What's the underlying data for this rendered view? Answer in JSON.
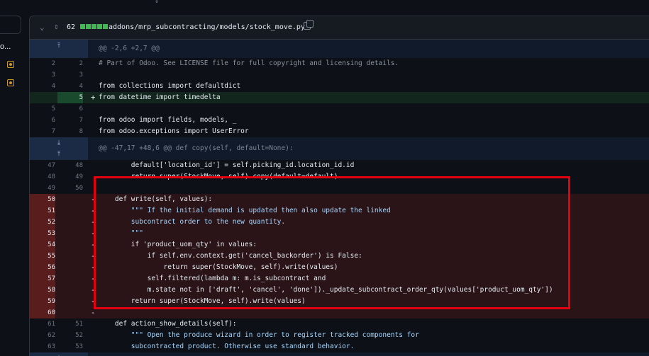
{
  "sidebar": {
    "truncated_label": "o..."
  },
  "file": {
    "count": "62",
    "path": "addons/mrp_subcontracting/models/stock_move.py",
    "diffstat_colors": [
      "#3fb950",
      "#3fb950",
      "#3fb950",
      "#3fb950",
      "#3fb950"
    ]
  },
  "hunks": {
    "h1": "@@ -2,6 +2,7 @@",
    "h2": "@@ -47,17 +48,6 @@ def copy(self, default=None):"
  },
  "lines": [
    {
      "l": "2",
      "r": "2",
      "sign": "",
      "code": "# Part of Odoo. See LICENSE file for full copyright and licensing details."
    },
    {
      "l": "3",
      "r": "3",
      "sign": "",
      "code": ""
    },
    {
      "l": "4",
      "r": "4",
      "sign": "",
      "code": "from collections import defaultdict"
    },
    {
      "l": "",
      "r": "5",
      "sign": "+",
      "code": "from datetime import timedelta"
    },
    {
      "l": "5",
      "r": "6",
      "sign": "",
      "code": ""
    },
    {
      "l": "6",
      "r": "7",
      "sign": "",
      "code": "from odoo import fields, models, _"
    },
    {
      "l": "7",
      "r": "8",
      "sign": "",
      "code": "from odoo.exceptions import UserError"
    },
    {
      "l": "47",
      "r": "48",
      "sign": "",
      "code": "        default['location_id'] = self.picking_id.location_id.id"
    },
    {
      "l": "48",
      "r": "49",
      "sign": "",
      "code": "        return super(StockMove, self).copy(default=default)"
    },
    {
      "l": "49",
      "r": "50",
      "sign": "",
      "code": ""
    },
    {
      "l": "50",
      "r": "",
      "sign": "-",
      "code": "    def write(self, values):"
    },
    {
      "l": "51",
      "r": "",
      "sign": "-",
      "code": "        \"\"\" If the initial demand is updated then also update the linked"
    },
    {
      "l": "52",
      "r": "",
      "sign": "-",
      "code": "        subcontract order to the new quantity."
    },
    {
      "l": "53",
      "r": "",
      "sign": "-",
      "code": "        \"\"\""
    },
    {
      "l": "54",
      "r": "",
      "sign": "-",
      "code": "        if 'product_uom_qty' in values:"
    },
    {
      "l": "55",
      "r": "",
      "sign": "-",
      "code": "            if self.env.context.get('cancel_backorder') is False:"
    },
    {
      "l": "56",
      "r": "",
      "sign": "-",
      "code": "                return super(StockMove, self).write(values)"
    },
    {
      "l": "57",
      "r": "",
      "sign": "-",
      "code": "            self.filtered(lambda m: m.is_subcontract and"
    },
    {
      "l": "58",
      "r": "",
      "sign": "-",
      "code": "            m.state not in ['draft', 'cancel', 'done'])._update_subcontract_order_qty(values['product_uom_qty'])"
    },
    {
      "l": "59",
      "r": "",
      "sign": "-",
      "code": "        return super(StockMove, self).write(values)"
    },
    {
      "l": "60",
      "r": "",
      "sign": "-",
      "code": ""
    },
    {
      "l": "61",
      "r": "51",
      "sign": "",
      "code": "    def action_show_details(self):"
    },
    {
      "l": "62",
      "r": "52",
      "sign": "",
      "code": "        \"\"\" Open the produce wizard in order to register tracked components for"
    },
    {
      "l": "63",
      "r": "53",
      "sign": "",
      "code": "        subcontracted product. Otherwise use standard behavior."
    }
  ]
}
